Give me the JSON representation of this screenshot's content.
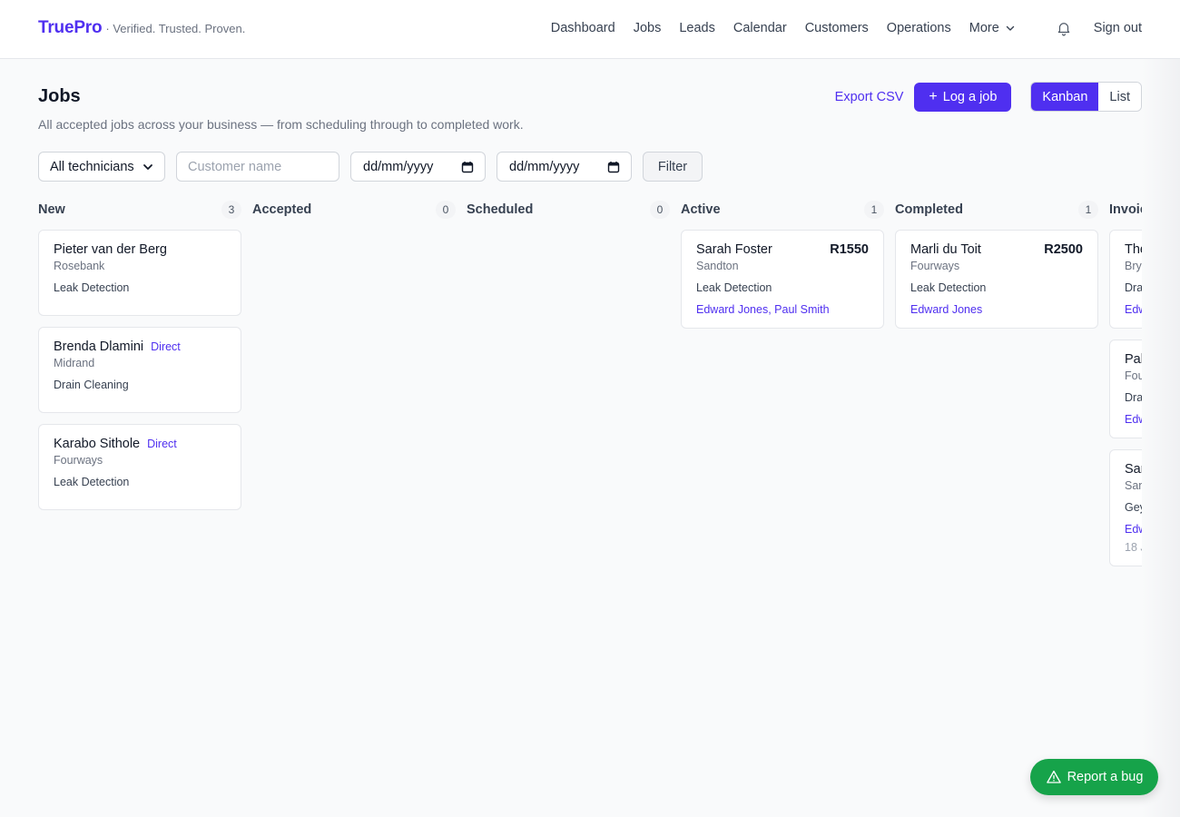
{
  "brand": {
    "name": "TruePro",
    "tagline": "· Verified. Trusted. Proven."
  },
  "nav": {
    "items": [
      "Dashboard",
      "Jobs",
      "Leads",
      "Calendar",
      "Customers",
      "Operations"
    ],
    "more": "More",
    "sign_out": "Sign out"
  },
  "page": {
    "title": "Jobs",
    "subtitle": "All accepted jobs across your business — from scheduling through to completed work."
  },
  "actions": {
    "export": "Export CSV",
    "log_job": "Log a job",
    "log_job_icon": "plus",
    "view_kanban": "Kanban",
    "view_list": "List",
    "active_view": "Kanban"
  },
  "filters": {
    "technician": "All technicians",
    "customer_placeholder": "Customer name",
    "date_from": "dd/mm/yyyy",
    "date_to": "dd/mm/yyyy",
    "filter_button": "Filter"
  },
  "board": {
    "columns": [
      {
        "title": "New",
        "count": "3",
        "cards": [
          {
            "name": "Pieter van der Berg",
            "location": "Rosebank",
            "service": "Leak Detection"
          },
          {
            "name": "Brenda Dlamini",
            "badge": "Direct",
            "location": "Midrand",
            "service": "Drain Cleaning"
          },
          {
            "name": "Karabo Sithole",
            "badge": "Direct",
            "location": "Fourways",
            "service": "Leak Detection"
          }
        ]
      },
      {
        "title": "Accepted",
        "count": "0",
        "cards": []
      },
      {
        "title": "Scheduled",
        "count": "0",
        "cards": []
      },
      {
        "title": "Active",
        "count": "1",
        "cards": [
          {
            "name": "Sarah Foster",
            "amount": "R1550",
            "location": "Sandton",
            "service": "Leak Detection",
            "technicians": "Edward Jones, Paul Smith"
          }
        ]
      },
      {
        "title": "Completed",
        "count": "1",
        "cards": [
          {
            "name": "Marli du Toit",
            "amount": "R2500",
            "location": "Fourways",
            "service": "Leak Detection",
            "technicians": "Edward Jones"
          }
        ]
      },
      {
        "title": "Invoic",
        "cards": [
          {
            "name": "The",
            "location": "Bry",
            "service": "Dra",
            "technicians": "Edw"
          },
          {
            "name": "Pal",
            "location": "Fou",
            "service": "Dra",
            "technicians": "Edw"
          },
          {
            "name": "Sar",
            "location": "San",
            "service": "Gey",
            "technicians": "Edw",
            "date": "18 J"
          }
        ]
      }
    ]
  },
  "report_bug": {
    "label": "Report a bug",
    "icon": "warning-triangle-icon"
  },
  "colors": {
    "accent": "#4f2ff0",
    "success": "#16a34a"
  }
}
